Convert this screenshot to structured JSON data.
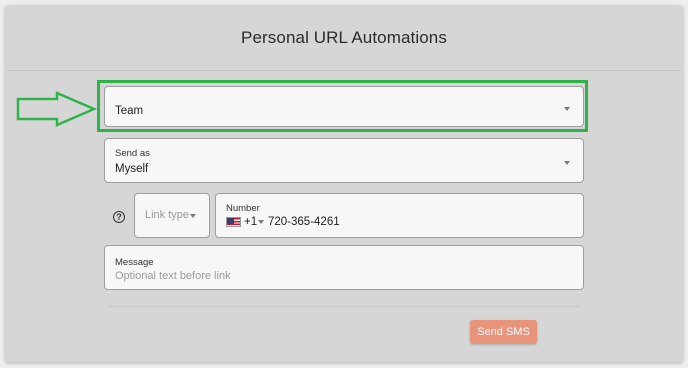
{
  "header": {
    "title": "Personal URL Automations"
  },
  "team_select": {
    "value": "Team"
  },
  "send_as": {
    "label": "Send as",
    "value": "Myself"
  },
  "link_type": {
    "placeholder": "Link type"
  },
  "number": {
    "label": "Number",
    "country_code": "+1",
    "value": "720-365-4261",
    "flag_icon": "us-flag-icon"
  },
  "message": {
    "label": "Message",
    "placeholder": "Optional text before link"
  },
  "help_icon": {
    "glyph": "?"
  },
  "send_button": {
    "label": "Send SMS"
  },
  "colors": {
    "highlight": "#2db34a",
    "send_button": "#e8947b"
  },
  "annotation": {
    "arrow_color": "#2db34a",
    "arrow_icon": "right-arrow-icon"
  }
}
